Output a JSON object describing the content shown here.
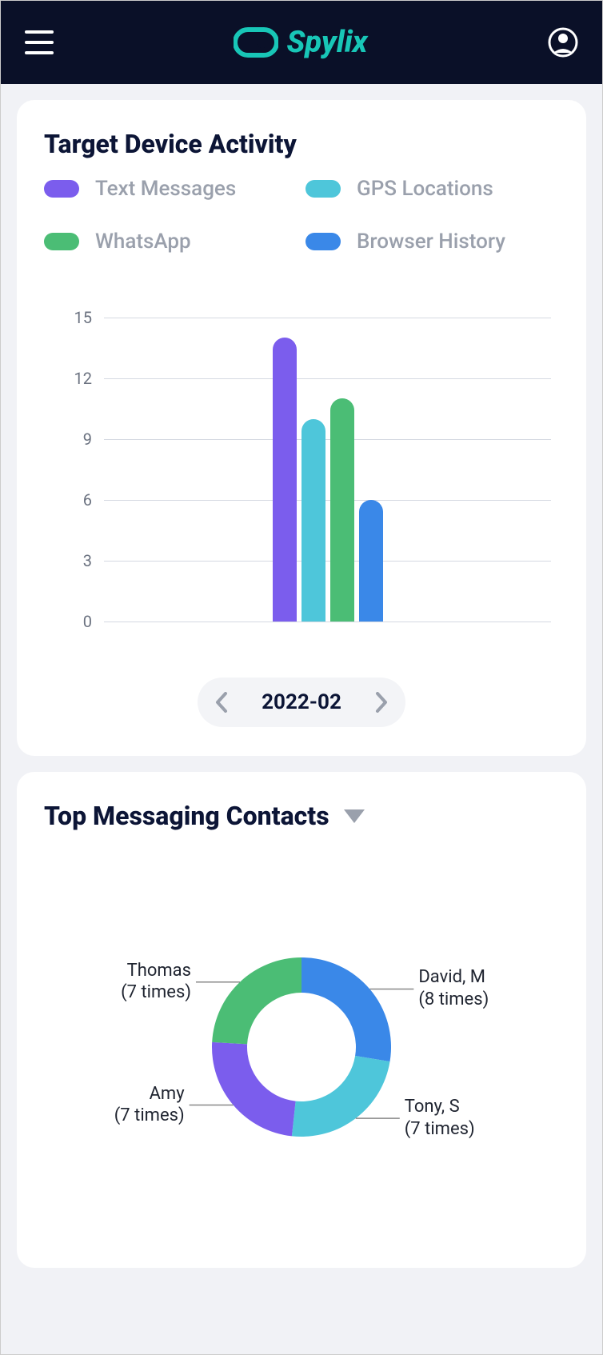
{
  "brand": {
    "name": "Spylix"
  },
  "colors": {
    "text_messages": "#7b5ded",
    "whatsapp": "#4bbd75",
    "gps_locations": "#4ec6da",
    "browser_history": "#3a88e8"
  },
  "activity_card": {
    "title": "Target Device Activity",
    "legend": [
      {
        "key": "text_messages",
        "label": "Text Messages"
      },
      {
        "key": "gps_locations",
        "label": "GPS Locations"
      },
      {
        "key": "whatsapp",
        "label": "WhatsApp"
      },
      {
        "key": "browser_history",
        "label": "Browser History"
      }
    ],
    "date": "2022-02"
  },
  "chart_data": {
    "type": "bar",
    "categories": [
      "Text Messages",
      "GPS Locations",
      "WhatsApp",
      "Browser History"
    ],
    "values": [
      14,
      10,
      11,
      6
    ],
    "color_keys": [
      "text_messages",
      "gps_locations",
      "whatsapp",
      "browser_history"
    ],
    "title": "Target Device Activity",
    "xlabel": "",
    "ylabel": "",
    "ylim": [
      0,
      15
    ],
    "yticks": [
      0,
      3,
      6,
      9,
      12,
      15
    ]
  },
  "contacts_card": {
    "title": "Top Messaging Contacts",
    "donut": {
      "slices": [
        {
          "name": "David, M",
          "count_label": "(8 times)",
          "value": 8,
          "color": "#3a88e8"
        },
        {
          "name": "Tony, S",
          "count_label": "(7 times)",
          "value": 7,
          "color": "#4ec6da"
        },
        {
          "name": "Amy",
          "count_label": "(7 times)",
          "value": 7,
          "color": "#7b5ded"
        },
        {
          "name": "Thomas",
          "count_label": "(7 times)",
          "value": 7,
          "color": "#4bbd75"
        }
      ]
    }
  }
}
